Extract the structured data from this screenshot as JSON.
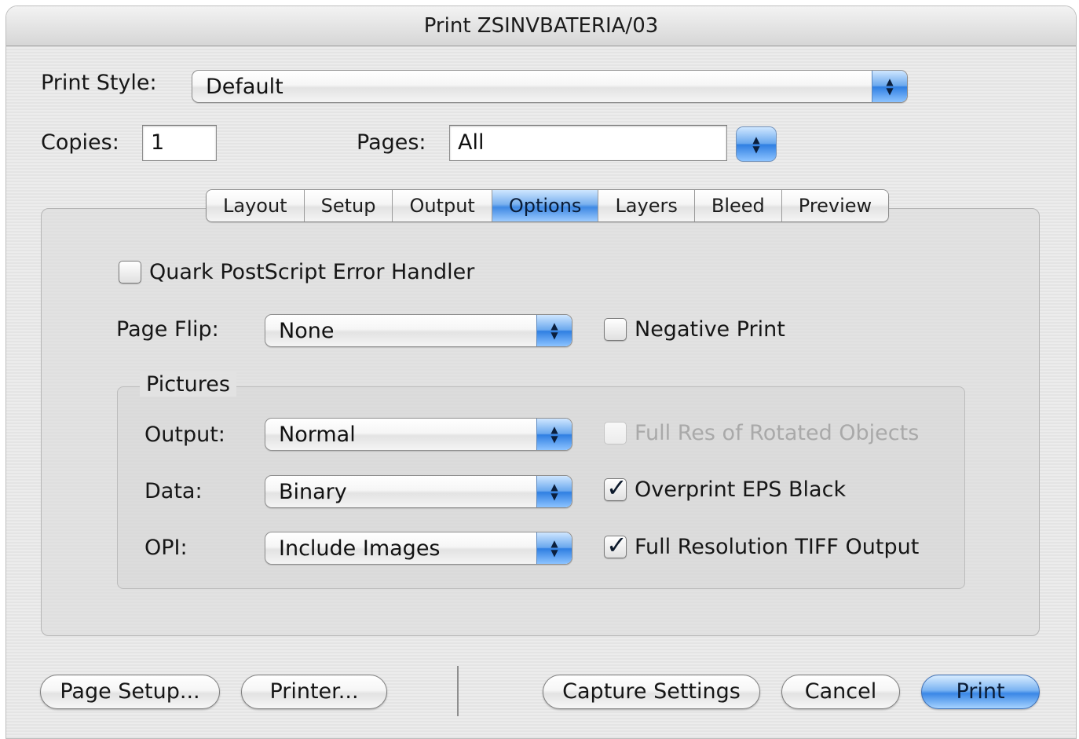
{
  "window": {
    "title": "Print ZSINVBATERIA/03"
  },
  "print_style": {
    "label": "Print Style:",
    "value": "Default"
  },
  "copies": {
    "label": "Copies:",
    "value": "1"
  },
  "pages": {
    "label": "Pages:",
    "value": "All"
  },
  "tabs": [
    {
      "label": "Layout",
      "active": false
    },
    {
      "label": "Setup",
      "active": false
    },
    {
      "label": "Output",
      "active": false
    },
    {
      "label": "Options",
      "active": true
    },
    {
      "label": "Layers",
      "active": false
    },
    {
      "label": "Bleed",
      "active": false
    },
    {
      "label": "Preview",
      "active": false
    }
  ],
  "options": {
    "error_handler": {
      "label": "Quark PostScript Error Handler",
      "checked": false
    },
    "page_flip": {
      "label": "Page Flip:",
      "value": "None"
    },
    "negative_print": {
      "label": "Negative Print",
      "checked": false
    },
    "pictures": {
      "title": "Pictures",
      "output": {
        "label": "Output:",
        "value": "Normal"
      },
      "data": {
        "label": "Data:",
        "value": "Binary"
      },
      "opi": {
        "label": "OPI:",
        "value": "Include Images"
      },
      "full_res_rotated": {
        "label": "Full Res of Rotated Objects",
        "checked": false,
        "enabled": false
      },
      "overprint_eps": {
        "label": "Overprint EPS Black",
        "checked": true
      },
      "full_res_tiff": {
        "label": "Full Resolution TIFF Output",
        "checked": true
      }
    }
  },
  "buttons": {
    "page_setup": "Page Setup...",
    "printer": "Printer...",
    "capture_settings": "Capture Settings",
    "cancel": "Cancel",
    "print": "Print"
  },
  "icons": {
    "stepper": "up-down-arrows-icon",
    "check": "checkmark-icon"
  },
  "colors": {
    "accent": "#3a87e6",
    "window_background": "#e8e8e8",
    "disabled_text": "#a9a9a9"
  }
}
